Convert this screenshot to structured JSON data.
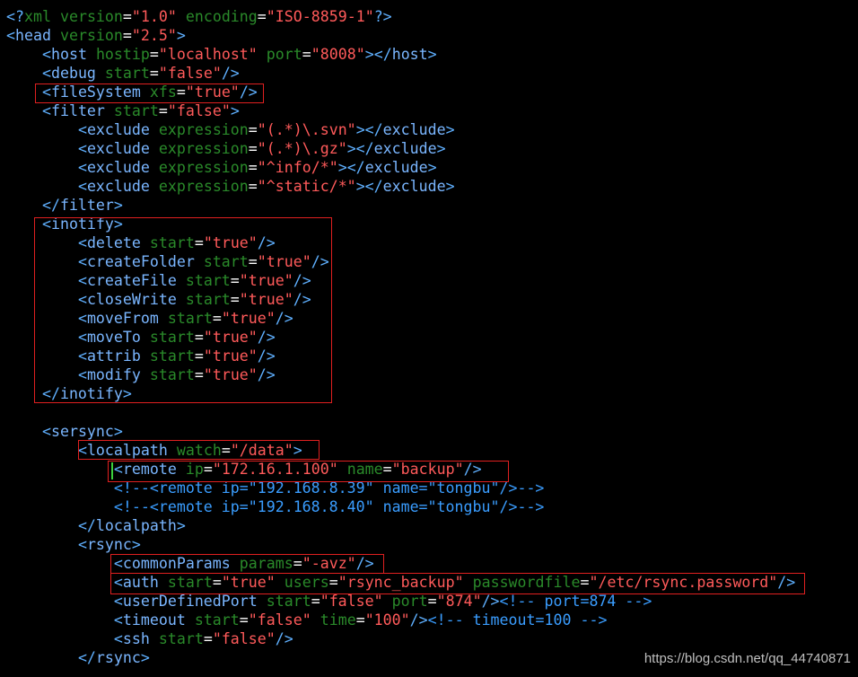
{
  "colors": {
    "background": "#000000",
    "bracket": "#5fb0ff",
    "tag": "#7ab6ff",
    "attribute": "#2a8a2a",
    "string": "#ff5a5a",
    "comment": "#3a9dff",
    "highlight_box": "#e02020"
  },
  "lines": [
    [
      [
        "pi",
        "<?"
      ],
      [
        "attr",
        "xml"
      ],
      [
        "text",
        " "
      ],
      [
        "attr",
        "version"
      ],
      [
        "eq",
        "="
      ],
      [
        "str",
        "\"1.0\""
      ],
      [
        "text",
        " "
      ],
      [
        "attr",
        "encoding"
      ],
      [
        "eq",
        "="
      ],
      [
        "str",
        "\"ISO-8859-1\""
      ],
      [
        "pi",
        "?>"
      ]
    ],
    [
      [
        "bracket",
        "<"
      ],
      [
        "tag",
        "head"
      ],
      [
        "text",
        " "
      ],
      [
        "attr",
        "version"
      ],
      [
        "eq",
        "="
      ],
      [
        "str",
        "\"2.5\""
      ],
      [
        "bracket",
        ">"
      ]
    ],
    [
      [
        "text",
        "    "
      ],
      [
        "bracket",
        "<"
      ],
      [
        "tag",
        "host"
      ],
      [
        "text",
        " "
      ],
      [
        "attr",
        "hostip"
      ],
      [
        "eq",
        "="
      ],
      [
        "str",
        "\"localhost\""
      ],
      [
        "text",
        " "
      ],
      [
        "attr",
        "port"
      ],
      [
        "eq",
        "="
      ],
      [
        "str",
        "\"8008\""
      ],
      [
        "bracket",
        "></"
      ],
      [
        "tag",
        "host"
      ],
      [
        "bracket",
        ">"
      ]
    ],
    [
      [
        "text",
        "    "
      ],
      [
        "bracket",
        "<"
      ],
      [
        "tag",
        "debug"
      ],
      [
        "text",
        " "
      ],
      [
        "attr",
        "start"
      ],
      [
        "eq",
        "="
      ],
      [
        "str",
        "\"false\""
      ],
      [
        "bracket",
        "/>"
      ]
    ],
    [
      [
        "text",
        "    "
      ],
      [
        "bracket",
        "<"
      ],
      [
        "tag",
        "fileSystem"
      ],
      [
        "text",
        " "
      ],
      [
        "attr",
        "xfs"
      ],
      [
        "eq",
        "="
      ],
      [
        "str",
        "\"true\""
      ],
      [
        "bracket",
        "/>"
      ]
    ],
    [
      [
        "text",
        "    "
      ],
      [
        "bracket",
        "<"
      ],
      [
        "tag",
        "filter"
      ],
      [
        "text",
        " "
      ],
      [
        "attr",
        "start"
      ],
      [
        "eq",
        "="
      ],
      [
        "str",
        "\"false\""
      ],
      [
        "bracket",
        ">"
      ]
    ],
    [
      [
        "text",
        "        "
      ],
      [
        "bracket",
        "<"
      ],
      [
        "tag",
        "exclude"
      ],
      [
        "text",
        " "
      ],
      [
        "attr",
        "expression"
      ],
      [
        "eq",
        "="
      ],
      [
        "str",
        "\"(.*)\\.svn\""
      ],
      [
        "bracket",
        "></"
      ],
      [
        "tag",
        "exclude"
      ],
      [
        "bracket",
        ">"
      ]
    ],
    [
      [
        "text",
        "        "
      ],
      [
        "bracket",
        "<"
      ],
      [
        "tag",
        "exclude"
      ],
      [
        "text",
        " "
      ],
      [
        "attr",
        "expression"
      ],
      [
        "eq",
        "="
      ],
      [
        "str",
        "\"(.*)\\.gz\""
      ],
      [
        "bracket",
        "></"
      ],
      [
        "tag",
        "exclude"
      ],
      [
        "bracket",
        ">"
      ]
    ],
    [
      [
        "text",
        "        "
      ],
      [
        "bracket",
        "<"
      ],
      [
        "tag",
        "exclude"
      ],
      [
        "text",
        " "
      ],
      [
        "attr",
        "expression"
      ],
      [
        "eq",
        "="
      ],
      [
        "str",
        "\"^info/*\""
      ],
      [
        "bracket",
        "></"
      ],
      [
        "tag",
        "exclude"
      ],
      [
        "bracket",
        ">"
      ]
    ],
    [
      [
        "text",
        "        "
      ],
      [
        "bracket",
        "<"
      ],
      [
        "tag",
        "exclude"
      ],
      [
        "text",
        " "
      ],
      [
        "attr",
        "expression"
      ],
      [
        "eq",
        "="
      ],
      [
        "str",
        "\"^static/*\""
      ],
      [
        "bracket",
        "></"
      ],
      [
        "tag",
        "exclude"
      ],
      [
        "bracket",
        ">"
      ]
    ],
    [
      [
        "text",
        "    "
      ],
      [
        "bracket",
        "</"
      ],
      [
        "tag",
        "filter"
      ],
      [
        "bracket",
        ">"
      ]
    ],
    [
      [
        "text",
        "    "
      ],
      [
        "bracket",
        "<"
      ],
      [
        "tag",
        "inotify"
      ],
      [
        "bracket",
        ">"
      ]
    ],
    [
      [
        "text",
        "        "
      ],
      [
        "bracket",
        "<"
      ],
      [
        "tag",
        "delete"
      ],
      [
        "text",
        " "
      ],
      [
        "attr",
        "start"
      ],
      [
        "eq",
        "="
      ],
      [
        "str",
        "\"true\""
      ],
      [
        "bracket",
        "/>"
      ]
    ],
    [
      [
        "text",
        "        "
      ],
      [
        "bracket",
        "<"
      ],
      [
        "tag",
        "createFolder"
      ],
      [
        "text",
        " "
      ],
      [
        "attr",
        "start"
      ],
      [
        "eq",
        "="
      ],
      [
        "str",
        "\"true\""
      ],
      [
        "bracket",
        "/>"
      ]
    ],
    [
      [
        "text",
        "        "
      ],
      [
        "bracket",
        "<"
      ],
      [
        "tag",
        "createFile"
      ],
      [
        "text",
        " "
      ],
      [
        "attr",
        "start"
      ],
      [
        "eq",
        "="
      ],
      [
        "str",
        "\"true\""
      ],
      [
        "bracket",
        "/>"
      ]
    ],
    [
      [
        "text",
        "        "
      ],
      [
        "bracket",
        "<"
      ],
      [
        "tag",
        "closeWrite"
      ],
      [
        "text",
        " "
      ],
      [
        "attr",
        "start"
      ],
      [
        "eq",
        "="
      ],
      [
        "str",
        "\"true\""
      ],
      [
        "bracket",
        "/>"
      ]
    ],
    [
      [
        "text",
        "        "
      ],
      [
        "bracket",
        "<"
      ],
      [
        "tag",
        "moveFrom"
      ],
      [
        "text",
        " "
      ],
      [
        "attr",
        "start"
      ],
      [
        "eq",
        "="
      ],
      [
        "str",
        "\"true\""
      ],
      [
        "bracket",
        "/>"
      ]
    ],
    [
      [
        "text",
        "        "
      ],
      [
        "bracket",
        "<"
      ],
      [
        "tag",
        "moveTo"
      ],
      [
        "text",
        " "
      ],
      [
        "attr",
        "start"
      ],
      [
        "eq",
        "="
      ],
      [
        "str",
        "\"true\""
      ],
      [
        "bracket",
        "/>"
      ]
    ],
    [
      [
        "text",
        "        "
      ],
      [
        "bracket",
        "<"
      ],
      [
        "tag",
        "attrib"
      ],
      [
        "text",
        " "
      ],
      [
        "attr",
        "start"
      ],
      [
        "eq",
        "="
      ],
      [
        "str",
        "\"true\""
      ],
      [
        "bracket",
        "/>"
      ]
    ],
    [
      [
        "text",
        "        "
      ],
      [
        "bracket",
        "<"
      ],
      [
        "tag",
        "modify"
      ],
      [
        "text",
        " "
      ],
      [
        "attr",
        "start"
      ],
      [
        "eq",
        "="
      ],
      [
        "str",
        "\"true\""
      ],
      [
        "bracket",
        "/>"
      ]
    ],
    [
      [
        "text",
        "    "
      ],
      [
        "bracket",
        "</"
      ],
      [
        "tag",
        "inotify"
      ],
      [
        "bracket",
        ">"
      ]
    ],
    [],
    [
      [
        "text",
        "    "
      ],
      [
        "bracket",
        "<"
      ],
      [
        "tag",
        "sersync"
      ],
      [
        "bracket",
        ">"
      ]
    ],
    [
      [
        "text",
        "        "
      ],
      [
        "bracket",
        "<"
      ],
      [
        "tag",
        "localpath"
      ],
      [
        "text",
        " "
      ],
      [
        "attr",
        "watch"
      ],
      [
        "eq",
        "="
      ],
      [
        "str",
        "\"/data\""
      ],
      [
        "bracket",
        ">"
      ]
    ],
    [
      [
        "text",
        "            "
      ],
      [
        "bracket",
        "<"
      ],
      [
        "tag",
        "remote"
      ],
      [
        "text",
        " "
      ],
      [
        "attr",
        "ip"
      ],
      [
        "eq",
        "="
      ],
      [
        "str",
        "\"172.16.1.100\""
      ],
      [
        "text",
        " "
      ],
      [
        "attr",
        "name"
      ],
      [
        "eq",
        "="
      ],
      [
        "str",
        "\"backup\""
      ],
      [
        "bracket",
        "/>"
      ]
    ],
    [
      [
        "text",
        "            "
      ],
      [
        "comment",
        "<!--<remote ip=\"192.168.8.39\" name=\"tongbu\"/>-->"
      ]
    ],
    [
      [
        "text",
        "            "
      ],
      [
        "comment",
        "<!--<remote ip=\"192.168.8.40\" name=\"tongbu\"/>-->"
      ]
    ],
    [
      [
        "text",
        "        "
      ],
      [
        "bracket",
        "</"
      ],
      [
        "tag",
        "localpath"
      ],
      [
        "bracket",
        ">"
      ]
    ],
    [
      [
        "text",
        "        "
      ],
      [
        "bracket",
        "<"
      ],
      [
        "tag",
        "rsync"
      ],
      [
        "bracket",
        ">"
      ]
    ],
    [
      [
        "text",
        "            "
      ],
      [
        "bracket",
        "<"
      ],
      [
        "tag",
        "commonParams"
      ],
      [
        "text",
        " "
      ],
      [
        "attr",
        "params"
      ],
      [
        "eq",
        "="
      ],
      [
        "str",
        "\"-avz\""
      ],
      [
        "bracket",
        "/>"
      ]
    ],
    [
      [
        "text",
        "            "
      ],
      [
        "bracket",
        "<"
      ],
      [
        "tag",
        "auth"
      ],
      [
        "text",
        " "
      ],
      [
        "attr",
        "start"
      ],
      [
        "eq",
        "="
      ],
      [
        "str",
        "\"true\""
      ],
      [
        "text",
        " "
      ],
      [
        "attr",
        "users"
      ],
      [
        "eq",
        "="
      ],
      [
        "str",
        "\"rsync_backup\""
      ],
      [
        "text",
        " "
      ],
      [
        "attr",
        "passwordfile"
      ],
      [
        "eq",
        "="
      ],
      [
        "str",
        "\"/etc/rsync.password\""
      ],
      [
        "bracket",
        "/>"
      ]
    ],
    [
      [
        "text",
        "            "
      ],
      [
        "bracket",
        "<"
      ],
      [
        "tag",
        "userDefinedPort"
      ],
      [
        "text",
        " "
      ],
      [
        "attr",
        "start"
      ],
      [
        "eq",
        "="
      ],
      [
        "str",
        "\"false\""
      ],
      [
        "text",
        " "
      ],
      [
        "attr",
        "port"
      ],
      [
        "eq",
        "="
      ],
      [
        "str",
        "\"874\""
      ],
      [
        "bracket",
        "/>"
      ],
      [
        "comment",
        "<!-- port=874 -->"
      ]
    ],
    [
      [
        "text",
        "            "
      ],
      [
        "bracket",
        "<"
      ],
      [
        "tag",
        "timeout"
      ],
      [
        "text",
        " "
      ],
      [
        "attr",
        "start"
      ],
      [
        "eq",
        "="
      ],
      [
        "str",
        "\"false\""
      ],
      [
        "text",
        " "
      ],
      [
        "attr",
        "time"
      ],
      [
        "eq",
        "="
      ],
      [
        "str",
        "\"100\""
      ],
      [
        "bracket",
        "/>"
      ],
      [
        "comment",
        "<!-- timeout=100 -->"
      ]
    ],
    [
      [
        "text",
        "            "
      ],
      [
        "bracket",
        "<"
      ],
      [
        "tag",
        "ssh"
      ],
      [
        "text",
        " "
      ],
      [
        "attr",
        "start"
      ],
      [
        "eq",
        "="
      ],
      [
        "str",
        "\"false\""
      ],
      [
        "bracket",
        "/>"
      ]
    ],
    [
      [
        "text",
        "        "
      ],
      [
        "bracket",
        "</"
      ],
      [
        "tag",
        "rsync"
      ],
      [
        "bracket",
        ">"
      ]
    ]
  ],
  "highlighted_blocks": [
    "fileSystem",
    "inotify",
    "localpath",
    "remote",
    "commonParams",
    "auth"
  ],
  "watermark": "https://blog.csdn.net/qq_44740871"
}
